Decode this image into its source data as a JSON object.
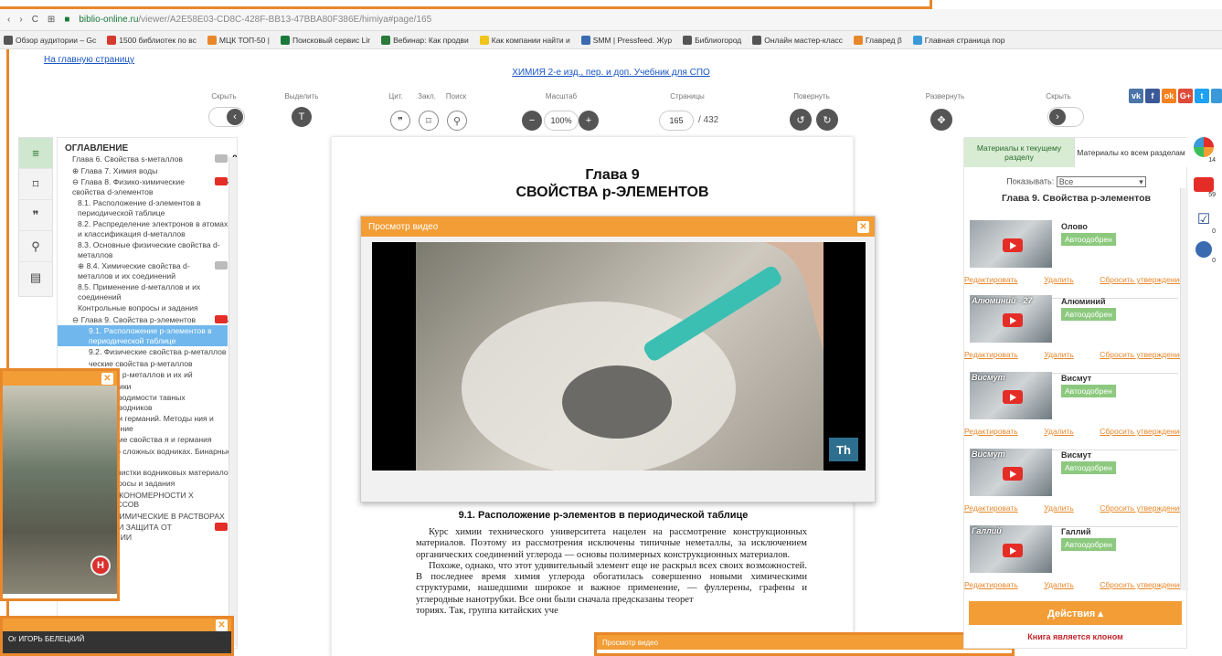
{
  "browser": {
    "url_host": "biblio-online.ru",
    "url_path": "/viewer/A2E58E03-CD8C-428F-BB13-47BBA80F386E/himiya#page/165",
    "bookmarks": [
      "Обзор аудитории – Gc",
      "1500 библиотек по вс",
      "МЦК ТОП-50 |",
      "Поисковый сервис Lir",
      "Вебинар: Как продви",
      "Как компании найти и",
      "SMM | Pressfeed. Жур",
      "Библиогород",
      "Онлайн мастер-класс",
      "Главред β",
      "Главная страница пор"
    ]
  },
  "header": {
    "home_link": "На главную страницу",
    "book_title": "ХИМИЯ 2-е изд., пер. и доп. Учебник для СПО"
  },
  "toolbar": {
    "hide_left": "Скрыть",
    "highlight": "Выделить",
    "cite": "Цит.",
    "bookmark": "Закл.",
    "search": "Поиск",
    "scale": "Масштаб",
    "zoom_value": "100%",
    "pages": "Страницы",
    "current_page": "165",
    "total_pages": "/ 432",
    "rotate": "Повернуть",
    "expand": "Развернуть",
    "hide_right": "Скрыть"
  },
  "toc": {
    "title": "ОГЛАВЛЕНИЕ",
    "items": [
      {
        "label": "Глава 6. Свойства s-металлов",
        "level": 1,
        "count": "9",
        "video": "grey"
      },
      {
        "label": "⊕ Глава 7. Химия воды",
        "level": 1
      },
      {
        "label": "⊖ Глава 8. Физико-химические свойства d-элементов",
        "level": 1,
        "count": "33",
        "video": "red"
      },
      {
        "label": "8.1. Расположение d-элементов в периодической таблице",
        "level": 2
      },
      {
        "label": "8.2. Распределение электронов в атомах и классификация d-металлов",
        "level": 2
      },
      {
        "label": "8.3. Основные физические свойства d-металлов",
        "level": 2
      },
      {
        "label": "⊕ 8.4. Химические свойства d-металлов и их соединений",
        "level": 2,
        "count": "1",
        "video": "grey"
      },
      {
        "label": "8.5. Применение d-металлов и их соединений",
        "level": 2
      },
      {
        "label": "Контрольные вопросы и задания",
        "level": 2
      },
      {
        "label": "⊖ Глава 9. Свойства p-элементов",
        "level": 1,
        "count": "14",
        "video": "red"
      },
      {
        "label": "9.1. Расположение p-элементов в периодической таблице",
        "level": 3,
        "selected": true
      },
      {
        "label": "9.2. Физические свойства p-металлов",
        "level": 3
      },
      {
        "label": "ческие свойства p-металлов",
        "level": 3
      },
      {
        "label": "менение p-металлов и их ий",
        "level": 3
      },
      {
        "label": "проводники",
        "level": 3
      },
      {
        "label": "ипы проводимости тавных полупроводников",
        "level": 3
      },
      {
        "label": "ремний и германий. Методы ния и применение",
        "level": 3
      },
      {
        "label": "имические свойства я и германия",
        "level": 3
      },
      {
        "label": "онятие о сложных водниках. Бинарные водники",
        "level": 3
      },
      {
        "label": "етоды очистки водниковых материалов",
        "level": 3
      },
      {
        "label": "ные вопросы и задания",
        "level": 3
      },
      {
        "label": "ЩИЕ ЗАКОНОМЕРНОСТИ Х ПРОЦЕССОВ",
        "level": 3
      },
      {
        "label": "ЕКТРОХИМИЧЕСКИЕ В РАСТВОРАХ",
        "level": 3
      },
      {
        "label": "РОЗИЯ И ЗАЩИТА ОТ КОРРОЗИИ",
        "level": 3,
        "count": "1",
        "video": "red"
      }
    ]
  },
  "page": {
    "chapter_line1": "Глава 9",
    "chapter_line2": "СВОЙСТВА p-ЭЛЕМЕНТОВ",
    "section_title": "9.1. Расположение p-элементов в периодической таблице",
    "para1": "Курс химии технического университета нацелен на рассмотрение конструкционных материалов. Поэтому из рассмотрения исключены типичные неметаллы, за исключением органических соединений углерода — основы полимерных конструкционных материалов.",
    "para2": "Похоже, однако, что этот удивительный элемент еще не раскрыл всех своих возможностей. В последнее время химия углерода обогатилась совершенно новыми химическими структурами, нашедшими широкое и важное применение, — фуллерены, графены и углеродные нанотрубки. Все они были сначала предсказаны теорет",
    "para3": "ториях. Так, группа китайских уче"
  },
  "video_modal": {
    "title": "Просмотр видео",
    "watermark": "Th"
  },
  "left_video": {
    "badge": "H"
  },
  "bottom_video": {
    "caption": "Ог ИГОРЬ БЕЛЕЦКИЙ"
  },
  "bottom_modal": {
    "title": "Просмотр видео"
  },
  "right_panel": {
    "tab_current": "Материалы к текущему разделу",
    "tab_all": "Материалы ко всем разделам",
    "show_label": "Показывать:",
    "show_value": "Все",
    "chapter": "Глава 9. Свойства p-элементов",
    "approved": "Автоодобрен",
    "edit": "Редактировать",
    "delete": "Удалить",
    "reset": "Сбросить утверждение",
    "videos": [
      {
        "name": "Олово",
        "thumb_label": ""
      },
      {
        "name": "Алюминий",
        "thumb_label": "Алюминий - 27"
      },
      {
        "name": "Висмут",
        "thumb_label": "Висмут"
      },
      {
        "name": "Висмут",
        "thumb_label": "Висмут"
      },
      {
        "name": "Галлий",
        "thumb_label": "Галлий"
      }
    ],
    "actions": "Действия ▴",
    "clone_note": "Книга является клоном"
  },
  "far_right": {
    "counts": [
      "14",
      "59",
      "0",
      "0"
    ]
  },
  "colors": {
    "accent": "#f29d36",
    "youtube": "#e52d27",
    "approved": "#8cc97e",
    "link": "#1a56c4"
  }
}
